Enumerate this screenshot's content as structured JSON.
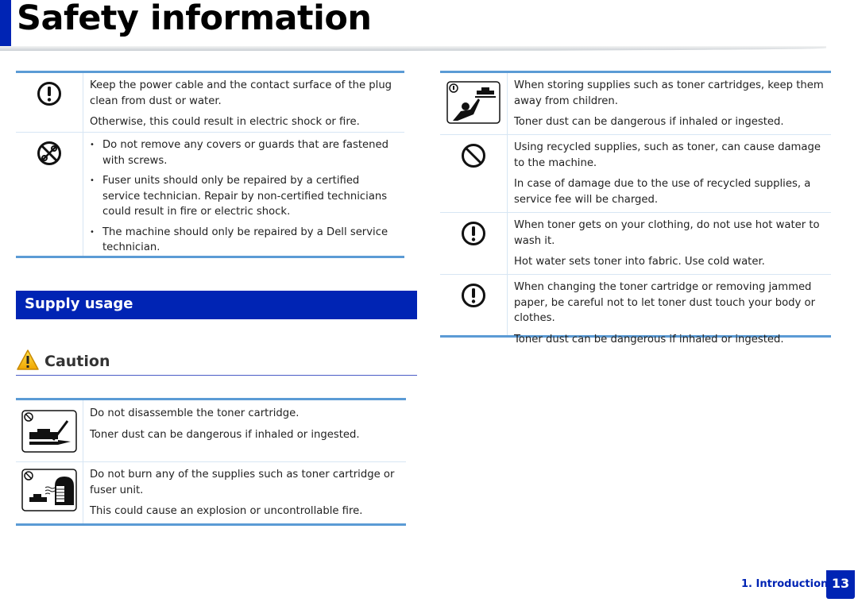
{
  "header": {
    "title": "Safety information"
  },
  "left_table": {
    "rows": [
      {
        "icon": "warning-mandatory-icon",
        "paragraphs": [
          "Keep the power cable and the contact surface of the plug clean from dust or water.",
          "Otherwise, this could result in electric shock or fire."
        ]
      },
      {
        "icon": "no-disassembly-icon",
        "bullets": [
          "Do not remove any covers or guards that are fastened with screws.",
          "Fuser units should only be repaired by a certified service technician. Repair by non-certified technicians could result in fire or electric shock.",
          "The machine should only be repaired by a Dell service technician."
        ]
      }
    ]
  },
  "section": {
    "title": "Supply usage"
  },
  "caution": {
    "label": "Caution",
    "icon": "caution-triangle-icon"
  },
  "supply_table": {
    "rows": [
      {
        "icon": "no-disassemble-cartridge-icon",
        "paragraphs": [
          "Do not disassemble the toner cartridge.",
          "Toner dust can be dangerous if inhaled or ingested."
        ]
      },
      {
        "icon": "no-burn-supplies-icon",
        "paragraphs": [
          "Do not burn any of the supplies such as toner cartridge or fuser unit.",
          "This could cause an explosion or uncontrollable fire."
        ]
      }
    ]
  },
  "right_table": {
    "rows": [
      {
        "icon": "keep-from-children-icon",
        "paragraphs": [
          "When storing supplies such as toner cartridges, keep them away from children.",
          "Toner dust can be dangerous if inhaled or ingested."
        ]
      },
      {
        "icon": "prohibited-icon",
        "paragraphs": [
          "Using recycled supplies, such as toner, can cause damage to the machine.",
          "In case of damage due to the use of recycled supplies, a service fee will be charged."
        ]
      },
      {
        "icon": "warning-mandatory-icon",
        "paragraphs": [
          "When toner gets on your clothing, do not use hot water to wash it.",
          "Hot water sets toner into fabric. Use cold water."
        ]
      },
      {
        "icon": "warning-mandatory-icon",
        "paragraphs": [
          "When changing the toner cartridge or removing jammed paper, be careful not to let toner dust touch your body or clothes.",
          "Toner dust can be dangerous if inhaled or ingested."
        ]
      }
    ]
  },
  "footer": {
    "chapter": "1. Introduction",
    "page": "13"
  },
  "colors": {
    "brand_blue": "#0024b4",
    "table_rule": "#5b9bd5"
  }
}
